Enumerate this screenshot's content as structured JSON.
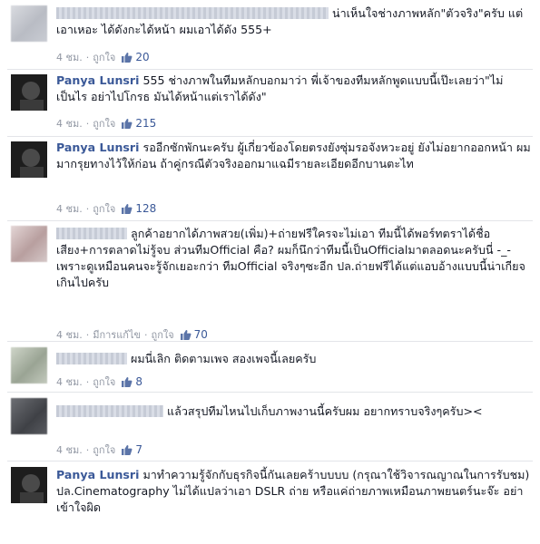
{
  "comments": [
    {
      "name": "",
      "text": "น่าเห็นใจช่างภาพหลัก\"ตัวจริง\"ครับ แต่เอาเหอะ ได้ดังกะได้หน้า ผมเอาได้ดัง 555+",
      "time": "4 ชม.",
      "like_label": "ถูกใจ",
      "likes": "20"
    },
    {
      "name": "Panya Lunsri",
      "text": "555 ช่างภาพในทีมหลักบอกมาว่า พี่เจ้าของทีมหลักพูดแบบนี้เป๊ะเลยว่า\"ไม่เป็นไร อย่าไปโกรธ มันได้หน้าแต่เราได้ดัง\"",
      "time": "4 ชม.",
      "like_label": "ถูกใจ",
      "likes": "215"
    },
    {
      "name": "Panya Lunsri",
      "text": "รออีกซักพักนะครับ ผู้เกี่ยวข้องโดยตรงยังซุ่มรอจังหวะอยู่ ยังไม่อยากออกหน้า ผมมากรุยทางไว้ให้ก่อน ถ้าคู่กรณีตัวจริงออกมาแฉมีรายละเอียดอีกบานตะไท",
      "time": "4 ชม.",
      "like_label": "ถูกใจ",
      "likes": "128"
    },
    {
      "name": "",
      "text": "ลูกค้าอยากได้ภาพสวย(เพิ่ม)+ถ่ายฟรีใครจะไม่เอา ทีมนี้ได้พอร์ทตราได้ชื่อเสียง+การตลาดไม่รู้จบ ส่วนทีมOfficial คือ? ผมก็นึกว่าทีมนี้เป็นOfficialมาตลอดนะครับนี่ -_- เพราะดูเหมือนคนจะรู้จักเยอะกว่า ทีมOfficial จริงๆซะอีก ปล.ถ่ายฟรีได้แต่แอบอ้างแบบนี้น่าเกียจเกินไปครับ",
      "time": "4 ชม.",
      "edited_label": "มีการแก้ไข",
      "like_label": "ถูกใจ",
      "likes": "70"
    },
    {
      "name": "",
      "text": "ผมนี่เลิก ติดตามเพจ สองเพจนี้เลยครับ",
      "time": "4 ชม.",
      "like_label": "ถูกใจ",
      "likes": "8"
    },
    {
      "name": "",
      "text": "แล้วสรุปทีมไหนไปเก็บภาพงานนี้ครับผม อยากทราบจริงๆครับ><",
      "time": "4 ชม.",
      "like_label": "ถูกใจ",
      "likes": "7"
    },
    {
      "name": "Panya Lunsri",
      "text": "มาทำความรู้จักกับธุรกิจนี้กันเลยคร้าบบบบ (กรุณาใช้วิจารณญาณในการรับชม)",
      "text2": "ปล.Cinematography ไม่ได้แปลว่าเอา DSLR ถ่าย หรือแค่ถ่ายภาพเหมือนภาพยนตร์นะจ๊ะ อย่าเข้าใจผิด"
    }
  ],
  "colors": {
    "link": "#3b5998",
    "meta": "#9197a3",
    "text": "#141823"
  },
  "icons": {
    "like": "thumbs-up-icon"
  }
}
